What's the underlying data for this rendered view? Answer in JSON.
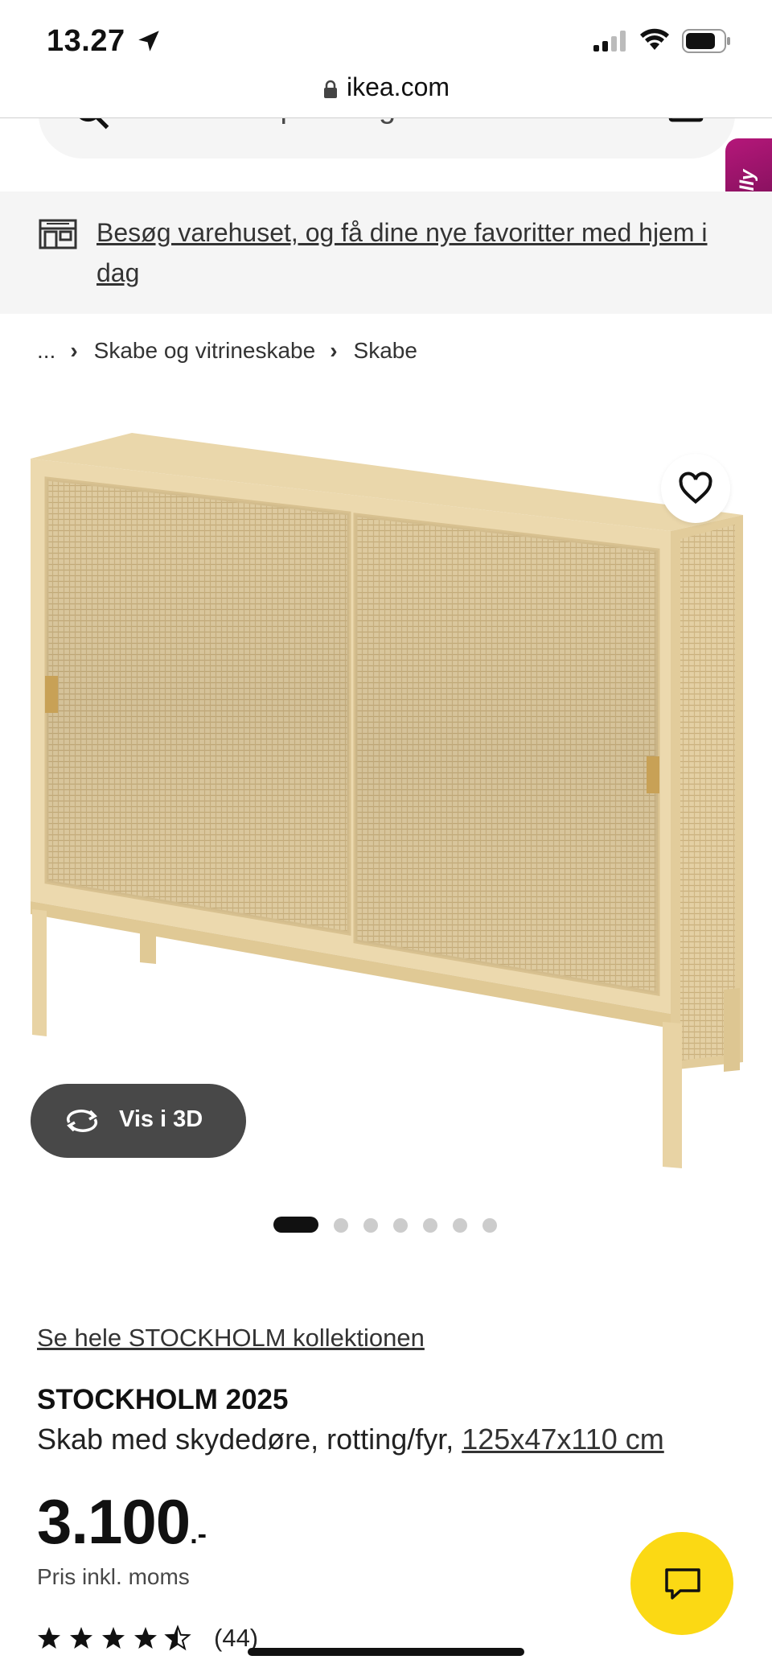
{
  "status_bar": {
    "time": "13.27",
    "url": "ikea.com"
  },
  "search": {
    "placeholder": "Hvad er du på udkig efter?"
  },
  "molly": {
    "label": "Molly"
  },
  "banner": {
    "text": "Besøg varehuset, og få dine nye favoritter med hjem i dag"
  },
  "breadcrumb": {
    "ellipsis": "...",
    "items": [
      "Skabe og vitrineskabe",
      "Skabe"
    ]
  },
  "gallery": {
    "view_3d_label": "Vis i 3D",
    "image_count": 7,
    "active_index": 0
  },
  "product": {
    "collection_link": "Se hele STOCKHOLM kollektionen",
    "name": "STOCKHOLM 2025",
    "description": "Skab med skydedøre, rotting/fyr,",
    "dimensions": "125x47x110 cm",
    "price": "3.100",
    "price_suffix": ".-",
    "vat_note": "Pris inkl. moms",
    "rating_stars": 4.5,
    "rating_count": "(44)"
  },
  "colors": {
    "accent_yellow": "#fbd914",
    "dark_button": "#484848",
    "molly_magenta": "#b5177a"
  }
}
